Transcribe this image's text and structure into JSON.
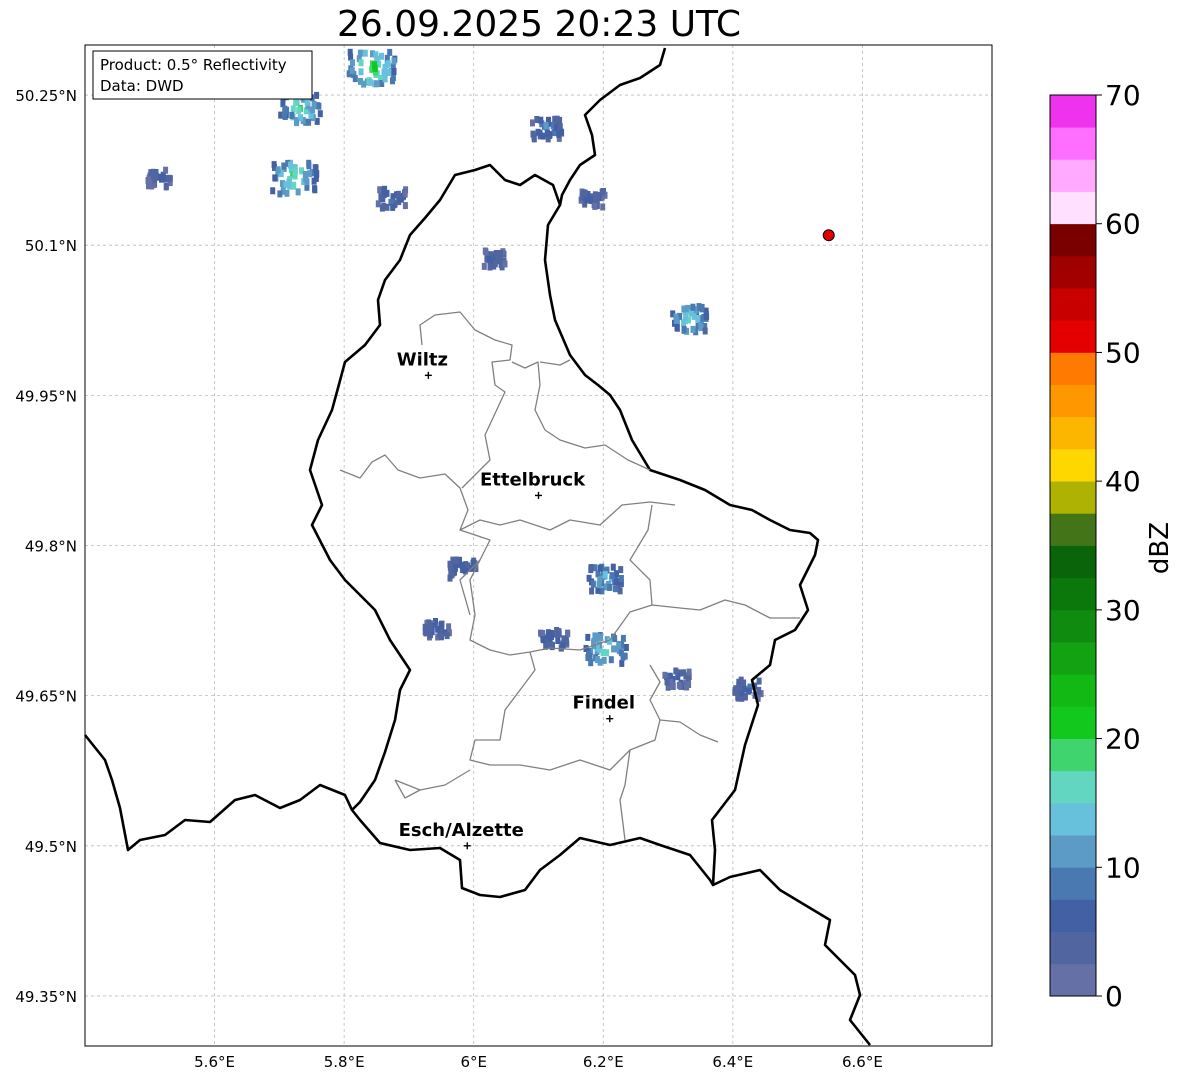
{
  "title": "26.09.2025 20:23 UTC",
  "info_box": {
    "line1": "Product: 0.5° Reflectivity",
    "line2": "Data: DWD"
  },
  "axes": {
    "lon_ticks": [
      {
        "value": 5.6,
        "label": "5.6°E"
      },
      {
        "value": 5.8,
        "label": "5.8°E"
      },
      {
        "value": 6.0,
        "label": "6°E"
      },
      {
        "value": 6.2,
        "label": "6.2°E"
      },
      {
        "value": 6.4,
        "label": "6.4°E"
      },
      {
        "value": 6.6,
        "label": "6.6°E"
      }
    ],
    "lat_ticks": [
      {
        "value": 50.25,
        "label": "50.25°N"
      },
      {
        "value": 50.1,
        "label": "50.1°N"
      },
      {
        "value": 49.95,
        "label": "49.95°N"
      },
      {
        "value": 49.8,
        "label": "49.8°N"
      },
      {
        "value": 49.65,
        "label": "49.65°N"
      },
      {
        "value": 49.5,
        "label": "49.5°N"
      },
      {
        "value": 49.35,
        "label": "49.35°N"
      }
    ],
    "lon_range": [
      5.4,
      6.8
    ],
    "lat_range": [
      49.3,
      50.3
    ],
    "grid": true
  },
  "cities": [
    {
      "name": "Wiltz",
      "lon": 5.93,
      "lat": 49.97
    },
    {
      "name": "Ettelbruck",
      "lon": 6.1,
      "lat": 49.85
    },
    {
      "name": "Findel",
      "lon": 6.21,
      "lat": 49.627
    },
    {
      "name": "Esch/Alzette",
      "lon": 5.99,
      "lat": 49.5
    }
  ],
  "radar_site": {
    "lon": 6.548,
    "lat": 50.11,
    "color": "#e00000"
  },
  "colorbar": {
    "label": "dBZ",
    "ticks": [
      "0",
      "10",
      "20",
      "30",
      "40",
      "50",
      "60",
      "70"
    ],
    "min": 0,
    "max": 70,
    "step": 2.5,
    "colors": [
      "#6470a6",
      "#5166a0",
      "#4260a3",
      "#4a78b0",
      "#5b9bc6",
      "#67c1dc",
      "#62d6c0",
      "#3fd46e",
      "#12c81c",
      "#12b814",
      "#12a212",
      "#0f8c0f",
      "#0b780b",
      "#0a640a",
      "#437518",
      "#aeb200",
      "#ffd700",
      "#fdb600",
      "#ff9800",
      "#ff7a00",
      "#e40000",
      "#c80000",
      "#a00000",
      "#7a0000",
      "#ffe0ff",
      "#ffaaff",
      "#ff6fff",
      "#ee32ee"
    ]
  },
  "chart_data": {
    "type": "map",
    "title": "26.09.2025 20:23 UTC",
    "colorbar_label": "dBZ",
    "colorbar_range": [
      0,
      70
    ],
    "radar_echoes": [
      {
        "lon": 5.73,
        "lat": 50.24,
        "dbz": 18
      },
      {
        "lon": 5.84,
        "lat": 50.28,
        "dbz": 22
      },
      {
        "lon": 5.72,
        "lat": 50.17,
        "dbz": 20
      },
      {
        "lon": 5.51,
        "lat": 50.17,
        "dbz": 6
      },
      {
        "lon": 5.87,
        "lat": 50.15,
        "dbz": 8
      },
      {
        "lon": 6.11,
        "lat": 50.22,
        "dbz": 10
      },
      {
        "lon": 6.18,
        "lat": 50.15,
        "dbz": 6
      },
      {
        "lon": 6.03,
        "lat": 50.09,
        "dbz": 6
      },
      {
        "lon": 6.33,
        "lat": 50.03,
        "dbz": 16
      },
      {
        "lon": 5.98,
        "lat": 49.78,
        "dbz": 8
      },
      {
        "lon": 6.2,
        "lat": 49.77,
        "dbz": 14
      },
      {
        "lon": 6.12,
        "lat": 49.71,
        "dbz": 8
      },
      {
        "lon": 6.2,
        "lat": 49.7,
        "dbz": 18
      },
      {
        "lon": 5.94,
        "lat": 49.72,
        "dbz": 6
      },
      {
        "lon": 6.31,
        "lat": 49.67,
        "dbz": 6
      },
      {
        "lon": 6.42,
        "lat": 49.66,
        "dbz": 8
      }
    ]
  }
}
